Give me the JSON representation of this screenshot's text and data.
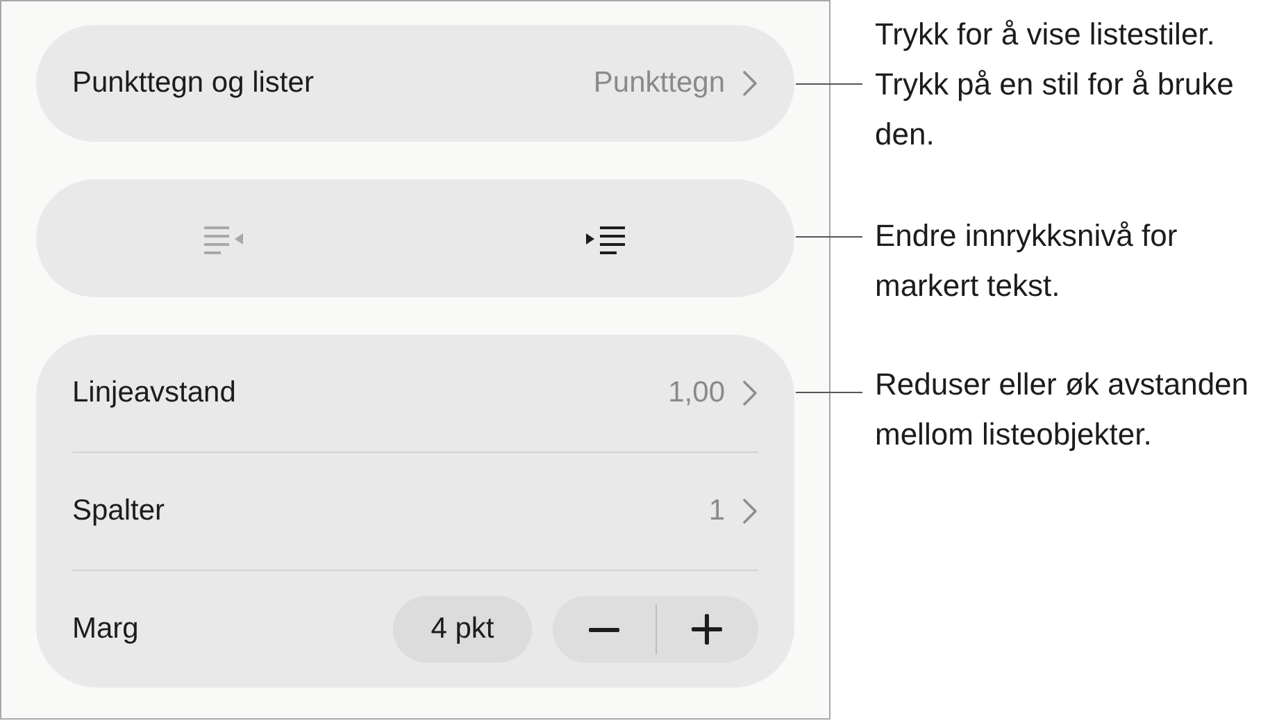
{
  "sections": [
    {
      "kind": "row",
      "label": "Punkttegn og lister",
      "value": "Punkttegn"
    },
    {
      "kind": "indent",
      "buttons": [
        {
          "kind": "outdent",
          "disabled": true
        },
        {
          "kind": "indent",
          "disabled": false
        }
      ]
    },
    {
      "kind": "group",
      "rows": [
        {
          "kind": "link",
          "label": "Linjeavstand",
          "value": "1,00"
        },
        {
          "kind": "link",
          "label": "Spalter",
          "value": "1"
        },
        {
          "kind": "stepper",
          "label": "Marg",
          "value": "4 pkt"
        }
      ]
    }
  ],
  "callouts": [
    {
      "text": "Trykk for å vise listestiler. Trykk på en stil for å bruke den."
    },
    {
      "text": "Endre innrykksnivå for markert tekst."
    },
    {
      "text": "Reduser eller øk avstanden mellom listeobjekter."
    }
  ]
}
